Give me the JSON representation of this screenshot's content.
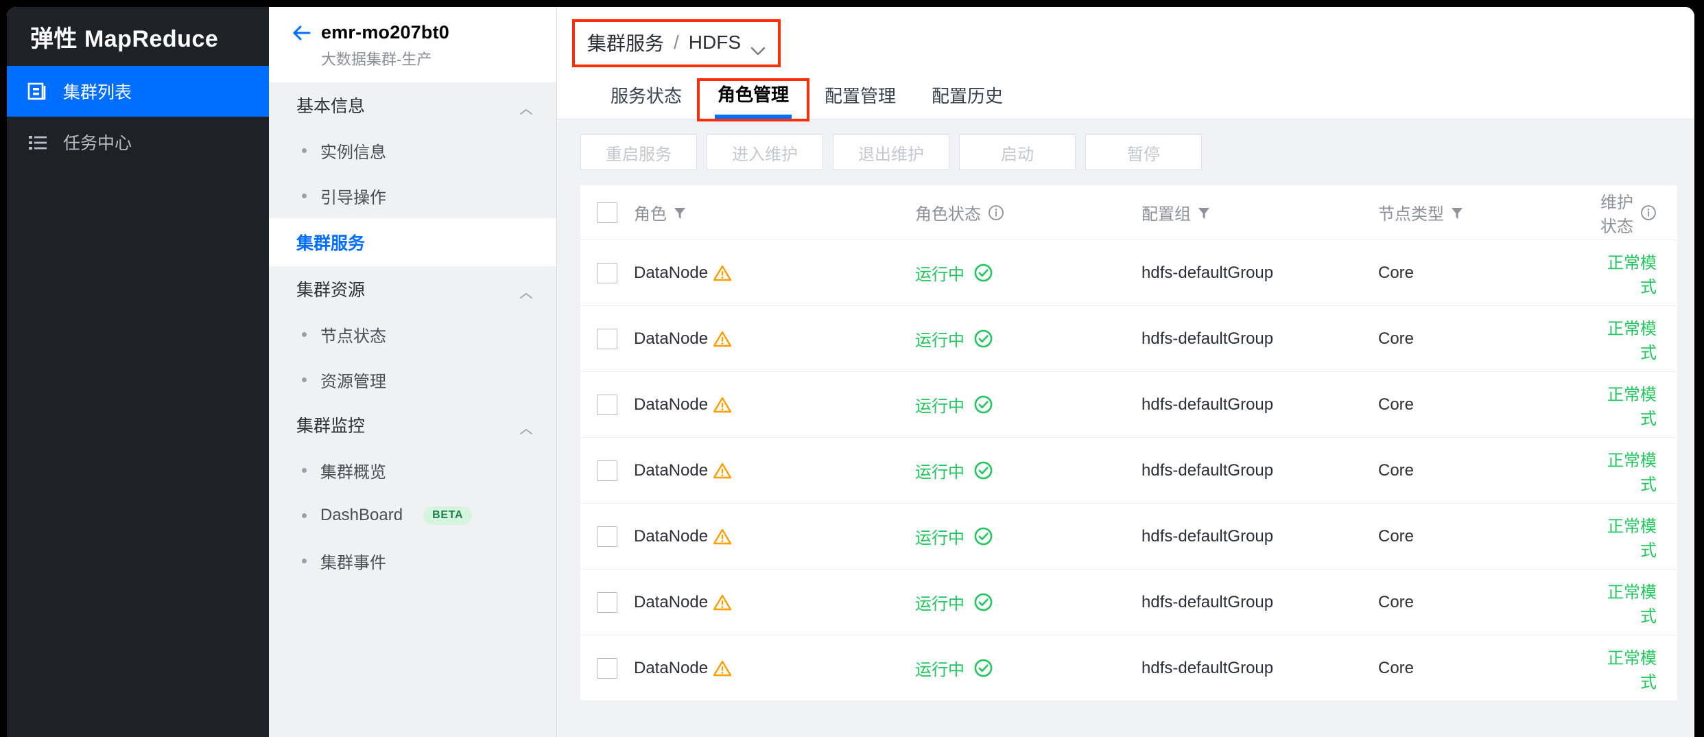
{
  "nav": {
    "brand": "弹性 MapReduce",
    "items": [
      {
        "label": "集群列表",
        "icon": "cluster-list-icon",
        "active": true
      },
      {
        "label": "任务中心",
        "icon": "task-center-icon",
        "active": false
      }
    ]
  },
  "sidebar": {
    "back_icon": "back-arrow-icon",
    "cluster_name": "emr-mo207bt0",
    "cluster_desc": "大数据集群-生产",
    "groups": [
      {
        "title": "基本信息",
        "collapse_icon": "chevron-up-icon",
        "items": [
          {
            "label": "实例信息"
          },
          {
            "label": "引导操作"
          }
        ]
      },
      {
        "title": "集群资源",
        "collapse_icon": "chevron-up-icon",
        "items": [
          {
            "label": "节点状态"
          },
          {
            "label": "资源管理"
          }
        ]
      },
      {
        "title": "集群监控",
        "collapse_icon": "chevron-up-icon",
        "items": [
          {
            "label": "集群概览"
          },
          {
            "label": "DashBoard",
            "badge": "BETA"
          },
          {
            "label": "集群事件"
          }
        ]
      }
    ],
    "service_entry": {
      "label": "集群服务",
      "active": true
    }
  },
  "breadcrumb": {
    "root": "集群服务",
    "separator": "/",
    "current": "HDFS",
    "dropdown_icon": "chevron-down-icon",
    "highlight_color": "#fc2e0a"
  },
  "tabs": [
    {
      "label": "服务状态",
      "selected": false,
      "boxed": false
    },
    {
      "label": "角色管理",
      "selected": true,
      "boxed": true
    },
    {
      "label": "配置管理",
      "selected": false,
      "boxed": false
    },
    {
      "label": "配置历史",
      "selected": false,
      "boxed": false
    }
  ],
  "toolbar": {
    "buttons": [
      {
        "label": "重启服务",
        "disabled": true
      },
      {
        "label": "进入维护",
        "disabled": true
      },
      {
        "label": "退出维护",
        "disabled": true
      },
      {
        "label": "启动",
        "disabled": true
      },
      {
        "label": "暂停",
        "disabled": true
      }
    ]
  },
  "table": {
    "select_all_checkbox": false,
    "columns": [
      {
        "key": "role",
        "label": "角色",
        "filter_icon": "filter-icon"
      },
      {
        "key": "state",
        "label": "角色状态",
        "info_icon": "info-circle-icon"
      },
      {
        "key": "group",
        "label": "配置组",
        "filter_icon": "filter-icon"
      },
      {
        "key": "node",
        "label": "节点类型",
        "filter_icon": "filter-icon"
      },
      {
        "key": "maint",
        "label": "维护状态",
        "info_icon": "info-circle-icon"
      }
    ],
    "rows": [
      {
        "checked": false,
        "role": "DataNode",
        "role_icon": "warning-triangle-icon",
        "state": "运行中",
        "state_icon": "check-circle-icon",
        "group": "hdfs-defaultGroup",
        "node": "Core",
        "maint": "正常模式"
      },
      {
        "checked": false,
        "role": "DataNode",
        "role_icon": "warning-triangle-icon",
        "state": "运行中",
        "state_icon": "check-circle-icon",
        "group": "hdfs-defaultGroup",
        "node": "Core",
        "maint": "正常模式"
      },
      {
        "checked": false,
        "role": "DataNode",
        "role_icon": "warning-triangle-icon",
        "state": "运行中",
        "state_icon": "check-circle-icon",
        "group": "hdfs-defaultGroup",
        "node": "Core",
        "maint": "正常模式"
      },
      {
        "checked": false,
        "role": "DataNode",
        "role_icon": "warning-triangle-icon",
        "state": "运行中",
        "state_icon": "check-circle-icon",
        "group": "hdfs-defaultGroup",
        "node": "Core",
        "maint": "正常模式"
      },
      {
        "checked": false,
        "role": "DataNode",
        "role_icon": "warning-triangle-icon",
        "state": "运行中",
        "state_icon": "check-circle-icon",
        "group": "hdfs-defaultGroup",
        "node": "Core",
        "maint": "正常模式"
      },
      {
        "checked": false,
        "role": "DataNode",
        "role_icon": "warning-triangle-icon",
        "state": "运行中",
        "state_icon": "check-circle-icon",
        "group": "hdfs-defaultGroup",
        "node": "Core",
        "maint": "正常模式"
      },
      {
        "checked": false,
        "role": "DataNode",
        "role_icon": "warning-triangle-icon",
        "state": "运行中",
        "state_icon": "check-circle-icon",
        "group": "hdfs-defaultGroup",
        "node": "Core",
        "maint": "正常模式"
      }
    ]
  },
  "colors": {
    "accent": "#006eff",
    "nav_bg": "#1f2129",
    "success": "#22c55e",
    "warning": "#ff9d00",
    "highlight": "#fc2e0a",
    "beta_bg": "#d6f5de",
    "beta_fg": "#17804a"
  }
}
